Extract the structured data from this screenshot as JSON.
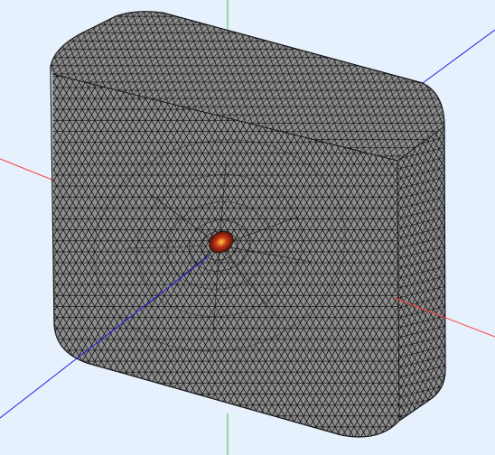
{
  "viewport": {
    "background": "#e6f1fd",
    "render_mode": "shaded-with-mesh-edges",
    "projection": "isometric"
  },
  "axes": {
    "x": {
      "color": "#ff3b3b"
    },
    "y": {
      "color": "#1f1fe6"
    },
    "z": {
      "color": "#33cc33"
    }
  },
  "model": {
    "shape": "rounded-box-with-through-hole",
    "face_color": "#8f8f8f",
    "edge_color": "#141414",
    "hole_interior_color": "#8a1a0c",
    "hole_highlight_color": "#ffd23a"
  }
}
